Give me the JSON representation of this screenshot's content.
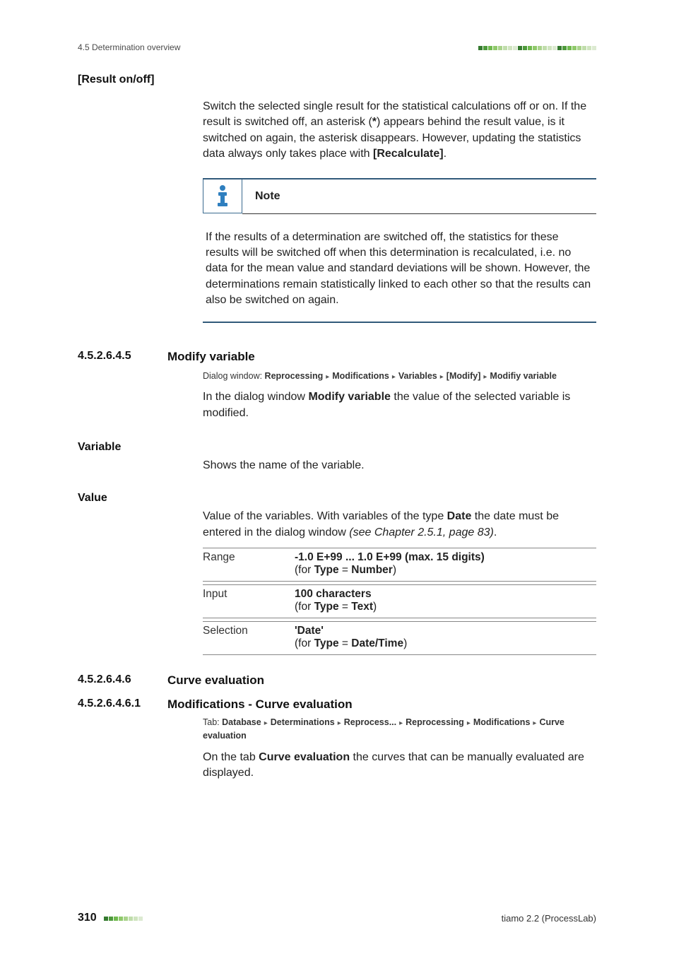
{
  "header": {
    "left": "4.5 Determination overview"
  },
  "resultOnOff": {
    "term": "[Result on/off]",
    "para_pre": "Switch the selected single result for the statistical calculations off or on. If the result is switched off, an asterisk (",
    "asterisk": "*",
    "para_mid": ") appears behind the result value, is it switched on again, the asterisk disappears. However, updating the statistics data always only takes place with ",
    "recalc": "[Recalculate]",
    "para_end": "."
  },
  "note": {
    "title": "Note",
    "body": "If the results of a determination are switched off, the statistics for these results will be switched off when this determination is recalculated, i.e. no data for the mean value and standard deviations will be shown. However, the determinations remain statistically linked to each other so that the results can also be switched on again."
  },
  "sec_modify": {
    "num": "4.5.2.6.4.5",
    "title": "Modify variable",
    "path_lead": "Dialog window: ",
    "path": [
      "Reprocessing",
      "Modifications",
      "Variables",
      "[Modify]",
      "Modifiy variable"
    ],
    "intro_pre": "In the dialog window ",
    "intro_strong": "Modify variable",
    "intro_post": " the value of the selected variable is modified."
  },
  "variable": {
    "term": "Variable",
    "text": "Shows the name of the variable."
  },
  "value": {
    "term": "Value",
    "para_pre": "Value of the variables. With variables of the type ",
    "para_strong": "Date",
    "para_mid": " the date must be entered in the dialog window ",
    "para_em": "(see Chapter 2.5.1, page 83)",
    "para_end": ".",
    "rows": [
      {
        "key": "Range",
        "main": "-1.0 E+99 ... 1.0 E+99 (max. 15 digits)",
        "sub_pre": "(for ",
        "sub_k": "Type",
        "sub_eq": " = ",
        "sub_v": "Number",
        "sub_post": ")"
      },
      {
        "key": "Input",
        "main": "100 characters",
        "sub_pre": "(for ",
        "sub_k": "Type",
        "sub_eq": " = ",
        "sub_v": "Text",
        "sub_post": ")"
      },
      {
        "key": "Selection",
        "main": "'Date'",
        "sub_pre": "(for ",
        "sub_k": "Type",
        "sub_eq": " = ",
        "sub_v": "Date/Time",
        "sub_post": ")"
      }
    ]
  },
  "sec_curve": {
    "num": "4.5.2.6.4.6",
    "title": "Curve evaluation"
  },
  "sec_curve_mod": {
    "num": "4.5.2.6.4.6.1",
    "title": "Modifications - Curve evaluation",
    "path_lead": "Tab: ",
    "path": [
      "Database",
      "Determinations",
      "Reprocess...",
      "Reprocessing",
      "Modifications",
      "Curve evaluation"
    ],
    "intro_pre": "On the tab ",
    "intro_strong": "Curve evaluation",
    "intro_post": " the curves that can be manually evaluated are displayed."
  },
  "footer": {
    "page": "310",
    "doc": "tiamo 2.2 (ProcessLab)"
  },
  "colors": {
    "bars": [
      "#357a2f",
      "#4e9a3b",
      "#6fb94d",
      "#8fc96a",
      "#a9d38b",
      "#c0ddab",
      "#cfe4bf",
      "#dcead1"
    ]
  }
}
